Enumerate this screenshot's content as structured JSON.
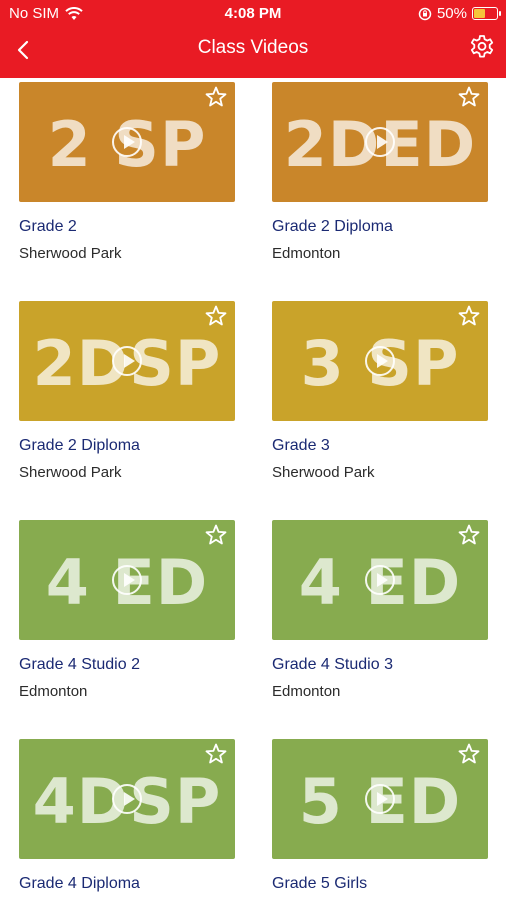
{
  "status_bar": {
    "carrier": "No SIM",
    "time": "4:08 PM",
    "battery": "50%",
    "battery_level": 0.5
  },
  "nav": {
    "title": "Class Videos"
  },
  "colors": {
    "header": "#e91b24",
    "orange": "#c9862a",
    "gold": "#c9a32a",
    "green": "#87ab4f"
  },
  "videos": [
    {
      "code": "2 SP",
      "title": "Grade 2",
      "location": "Sherwood Park",
      "color": "#c9862a"
    },
    {
      "code": "2DED",
      "title": "Grade 2 Diploma",
      "location": "Edmonton",
      "color": "#c9862a"
    },
    {
      "code": "2DSP",
      "title": "Grade 2 Diploma",
      "location": "Sherwood Park",
      "color": "#c9a32a"
    },
    {
      "code": "3 SP",
      "title": "Grade 3",
      "location": "Sherwood Park",
      "color": "#c9a32a"
    },
    {
      "code": "4 ED",
      "title": "Grade 4 Studio 2",
      "location": "Edmonton",
      "color": "#87ab4f"
    },
    {
      "code": "4 ED",
      "title": "Grade 4 Studio 3",
      "location": "Edmonton",
      "color": "#87ab4f"
    },
    {
      "code": "4DSP",
      "title": "Grade 4 Diploma",
      "location": "",
      "color": "#87ab4f"
    },
    {
      "code": "5 ED",
      "title": "Grade 5 Girls",
      "location": "",
      "color": "#87ab4f"
    }
  ]
}
